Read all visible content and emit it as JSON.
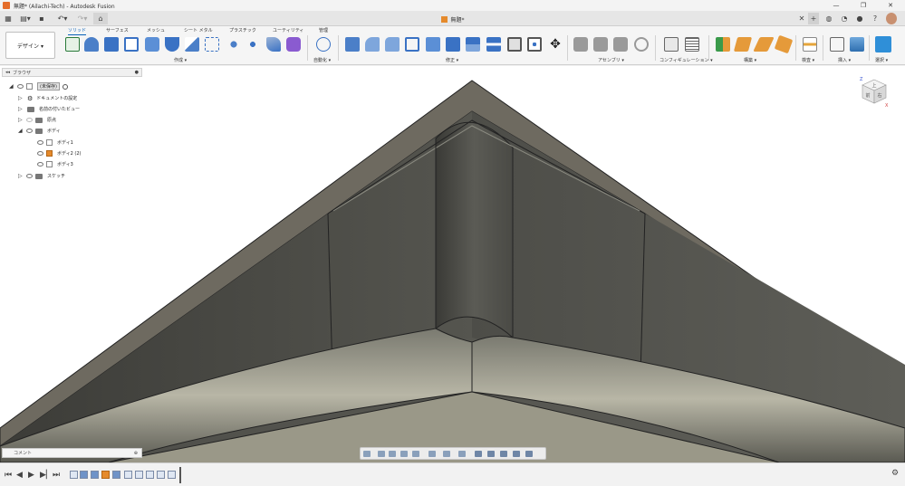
{
  "window": {
    "title": "無題* (Ailachi-Tech) - Autodesk Fusion"
  },
  "document_tab": {
    "label": "無題*"
  },
  "ribbon": {
    "workspace_button": "デザイン ▾",
    "tabs": [
      "ソリッド",
      "サーフェス",
      "メッシュ",
      "シート メタル",
      "プラスチック",
      "ユーティリティ",
      "管理"
    ],
    "groups": [
      "作成 ▾",
      "自動化 ▾",
      "修正 ▾",
      "アセンブリ ▾",
      "コンフィギュレーション ▾",
      "構築 ▾",
      "検査 ▾",
      "挿入 ▾",
      "選択 ▾"
    ]
  },
  "browser": {
    "title": "ブラウザ",
    "items": [
      {
        "label": "(未保存)",
        "level": 0
      },
      {
        "label": "ドキュメントの設定",
        "level": 1
      },
      {
        "label": "名前の付いたビュー",
        "level": 1
      },
      {
        "label": "原点",
        "level": 1
      },
      {
        "label": "ボディ",
        "level": 1
      },
      {
        "label": "ボディ1",
        "level": 2
      },
      {
        "label": "ボディ2 (2)",
        "level": 2
      },
      {
        "label": "ボディ3",
        "level": 2
      },
      {
        "label": "スケッチ",
        "level": 1
      }
    ]
  },
  "comments": {
    "label": "コメント"
  },
  "viewcube": {
    "faces": [
      "上",
      "右",
      "前"
    ],
    "axes": [
      "Z",
      "X"
    ]
  },
  "colors": {
    "accent": "#0a62b8",
    "model_dark": "#4a4a44",
    "model_rim": "#6e6a60"
  }
}
